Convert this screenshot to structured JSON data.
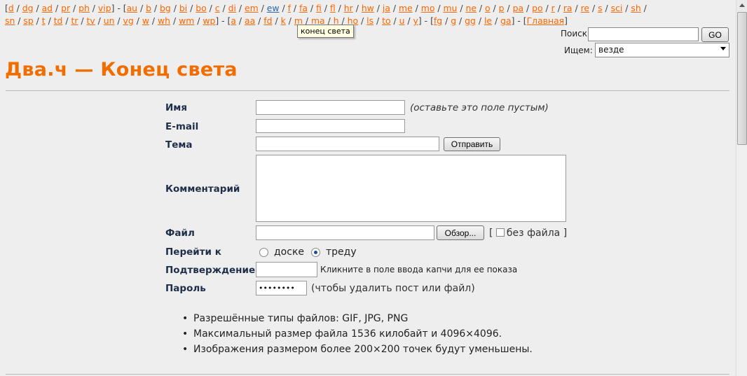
{
  "nav": {
    "line1": [
      "d",
      "dg",
      "ad",
      "pr",
      "ph",
      "vip",
      "au",
      "b",
      "bg",
      "bi",
      "bo",
      "c",
      "di",
      "em",
      "ew",
      "f",
      "fa",
      "fi",
      "fl",
      "hr",
      "hw",
      "ja",
      "me",
      "mo",
      "mu",
      "ne",
      "o",
      "p",
      "pa",
      "po",
      "r",
      "ra",
      "re",
      "s",
      "sci",
      "sh"
    ],
    "line2": [
      "sn",
      "sp",
      "t",
      "td",
      "tr",
      "tv",
      "un",
      "vg",
      "w",
      "wh",
      "wm",
      "wp",
      "a",
      "aa",
      "fd",
      "k",
      "m",
      "ma",
      "h",
      "ho",
      "ls",
      "to",
      "u",
      "y",
      "fg",
      "g",
      "gg",
      "le",
      "ga",
      "Главная"
    ],
    "hovered": "ew",
    "tooltip": "конец света"
  },
  "search": {
    "label": "Поиск",
    "button": "GO",
    "scope_label": "Ищем:",
    "scope_value": "везде"
  },
  "title": "Два.ч — Конец света",
  "form": {
    "name_label": "Имя",
    "name_hint": "(оставьте это поле пустым)",
    "email_label": "E-mail",
    "subject_label": "Тема",
    "submit_button": "Отправить",
    "comment_label": "Комментарий",
    "file_label": "Файл",
    "browse_button": "Обзор...",
    "no_file_label": "без файла",
    "goto_label": "Перейти к",
    "goto_options": [
      "доске",
      "треду"
    ],
    "goto_selected": "треду",
    "captcha_label": "Подтверждение",
    "captcha_hint": "Кликните в поле ввода капчи для ее показа",
    "password_label": "Пароль",
    "password_value": "••••••••",
    "password_hint": "(чтобы удалить пост или файл)"
  },
  "rules": [
    "Разрешённые типы файлов: GIF, JPG, PNG",
    "Максимальный размер файла 1536 килобайт и 4096×4096.",
    "Изображения размером более 200×200 точек будут уменьшены."
  ],
  "colors": {
    "title": "#f26d00",
    "link": "#ff6600",
    "label": "#1f2f4a",
    "background": "#eeeeee"
  }
}
